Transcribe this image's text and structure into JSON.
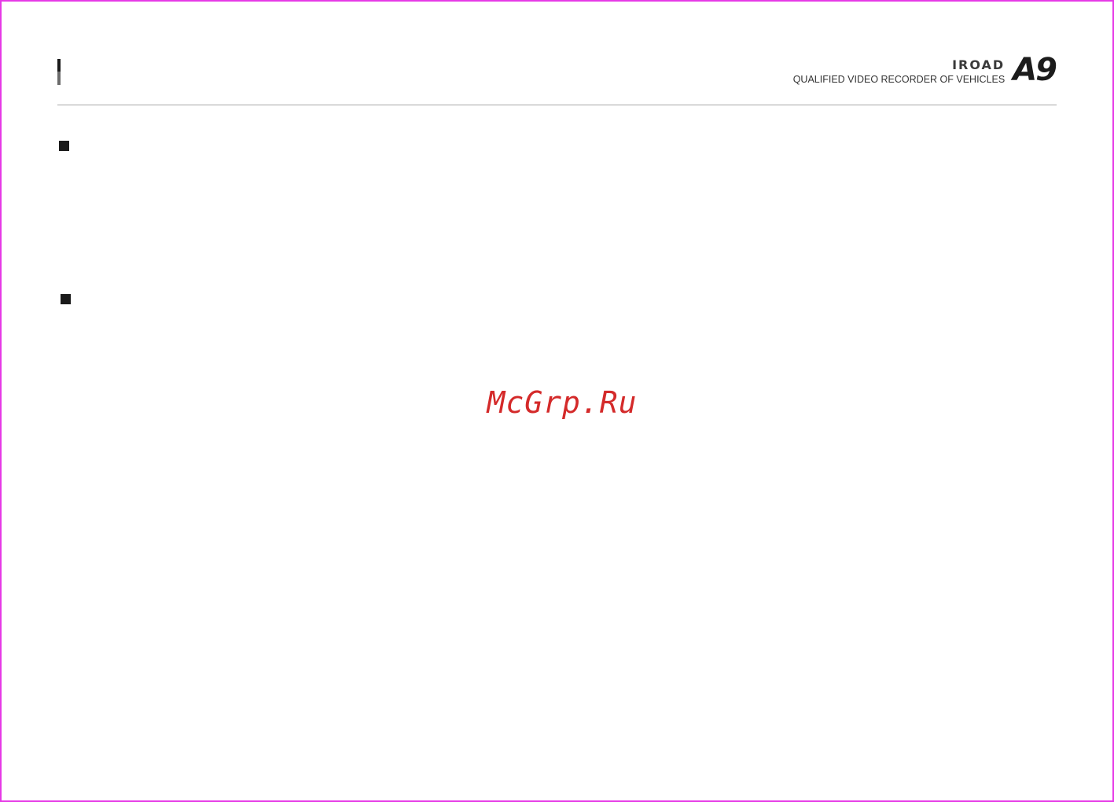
{
  "header": {
    "brand_name": "IROAD",
    "tagline": "QUALIFIED VIDEO RECORDER OF VEHICLES",
    "model": "A9"
  },
  "watermark": {
    "text": "McGrp.Ru"
  },
  "colors": {
    "frame": "#e63ae6",
    "watermark": "#d42a2a",
    "bullet": "#1a1a1a",
    "rule": "#a8a8a8"
  }
}
